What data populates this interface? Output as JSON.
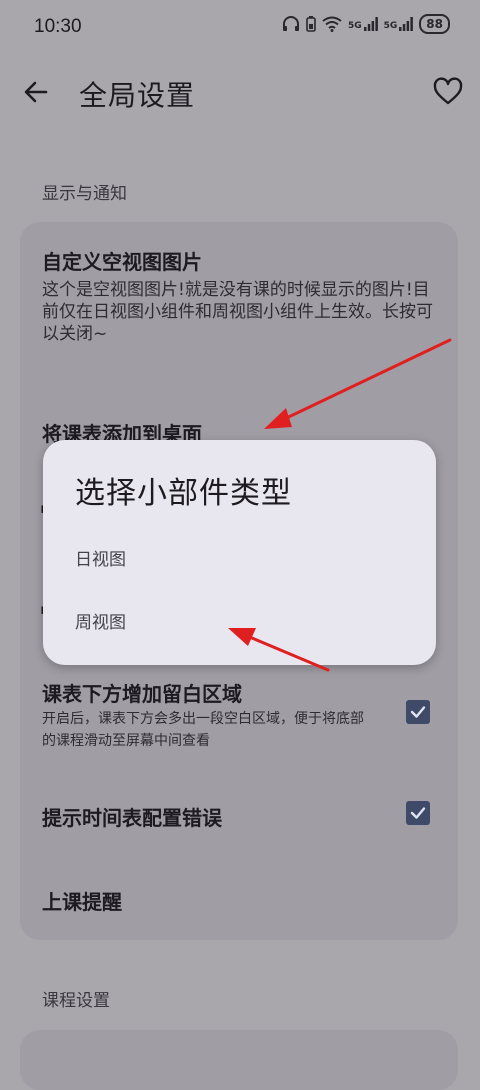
{
  "status_bar": {
    "time": "10:30",
    "battery": "88",
    "signal_1": "5G",
    "signal_2": "5G"
  },
  "app_bar": {
    "title": "全局设置",
    "back_icon": "arrow-left-icon",
    "favorite_icon": "heart-outline-icon"
  },
  "sections": {
    "display": "显示与通知",
    "course": "课程设置"
  },
  "prefs": {
    "empty_view": {
      "title": "自定义空视图图片",
      "summary": "这个是空视图图片!就是没有课的时候显示的图片!目前仅在日视图小组件和周视图小组件上生效。长按可以关闭~"
    },
    "add_to_desktop": {
      "title": "将课表添加到桌面"
    },
    "bottom_space": {
      "title": "课表下方增加留白区域",
      "summary": "开启后，课表下方会多出一段空白区域，便于将底部的课程滑动至屏幕中间查看",
      "checked": true
    },
    "timetable_error": {
      "title": "提示时间表配置错误",
      "checked": true
    },
    "class_reminder": {
      "title": "上课提醒"
    }
  },
  "dialog": {
    "title": "选择小部件类型",
    "options": [
      "日视图",
      "周视图"
    ]
  },
  "colors": {
    "scrim_background": "#a9a6ac",
    "card": "#a09da5",
    "dialog": "#e8e6ee",
    "checkbox": "#3e4a68",
    "annotation_arrow": "#e02020"
  }
}
